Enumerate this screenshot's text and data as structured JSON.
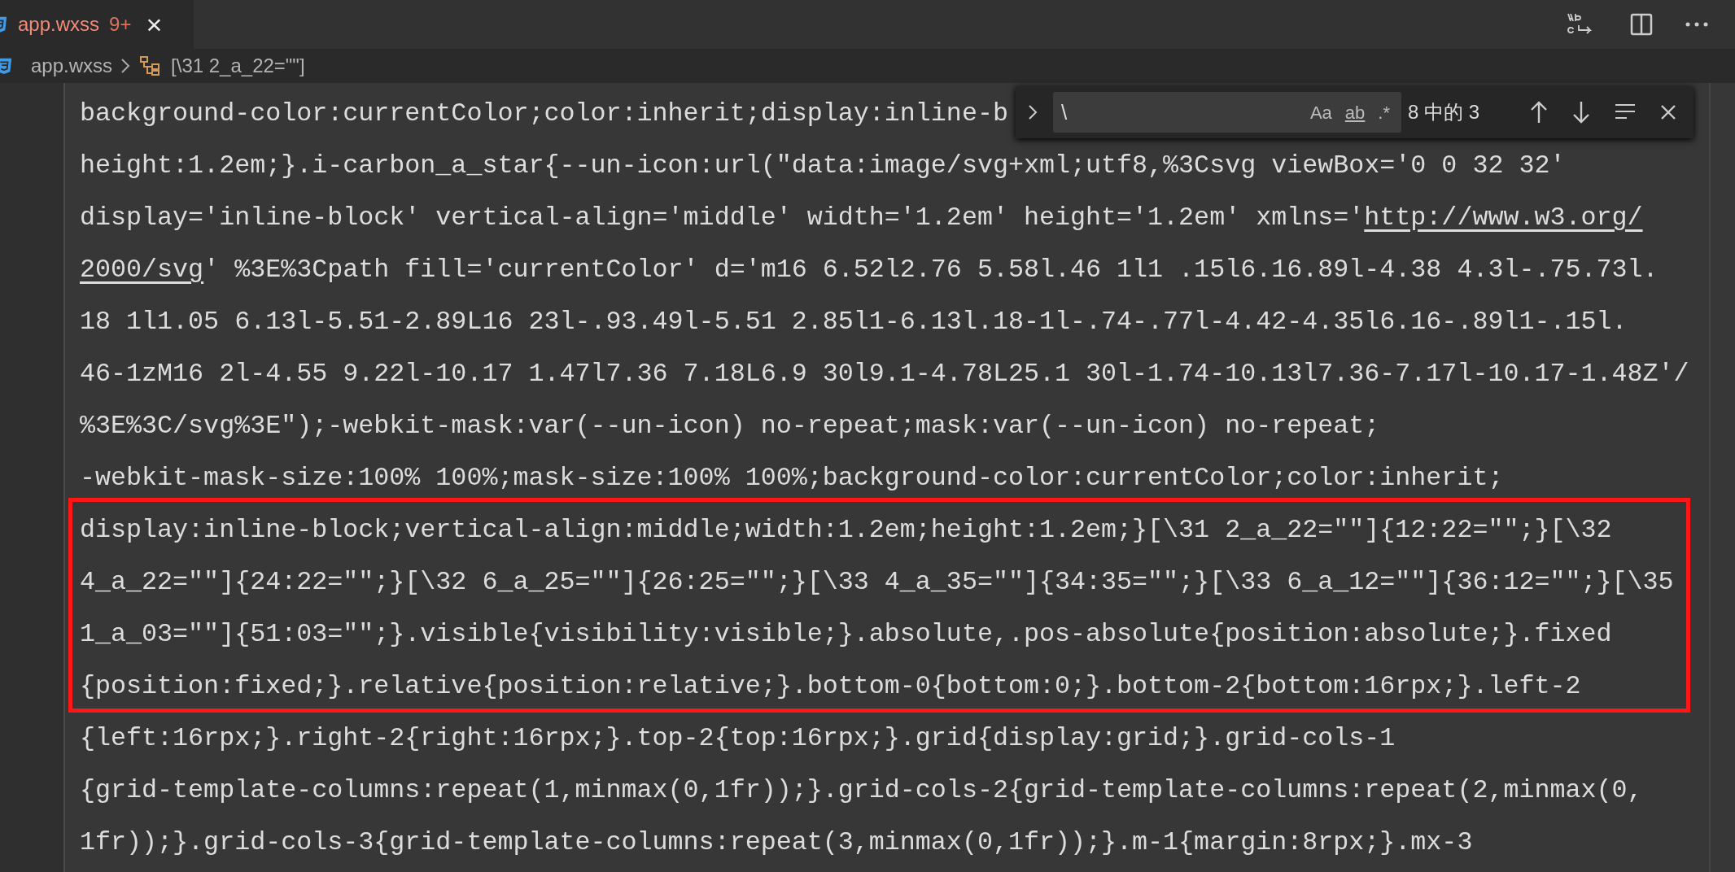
{
  "tab": {
    "label": "app.wxss",
    "badge": "9+",
    "close": "×",
    "selected": true
  },
  "breadcrumb": {
    "file": "app.wxss",
    "symbol": "[\\31 2_a_22=\"\"]"
  },
  "find": {
    "value": "\\",
    "toggles": [
      {
        "label": "Aa",
        "on": false
      },
      {
        "label": "ab",
        "on": false
      },
      {
        "label": ".*",
        "on": false
      }
    ],
    "count": "8 中的 3"
  },
  "lines": [
    {
      "parts": [
        {
          "kind": "code",
          "text": "background-color:currentColor;color:inherit;display:inline-b"
        }
      ]
    },
    {
      "parts": [
        {
          "kind": "code",
          "text": "height:1.2em;}.i-carbon_a_star{--un-icon:url(\"data:image/svg+xml;utf8,%3Csvg viewBox='0 0 32 32'"
        }
      ]
    },
    {
      "parts": [
        {
          "kind": "code",
          "text": "display='inline-block' vertical-align='middle' width='1.2em' height='1.2em' xmlns='"
        },
        {
          "kind": "link",
          "text": "http://www.w3.org/"
        }
      ]
    },
    {
      "parts": [
        {
          "kind": "link",
          "text": "2000/svg"
        },
        {
          "kind": "code",
          "text": "' %3E%3Cpath fill='currentColor' d='m16 6.52l2.76 5.58l.46 1l1 .15l6.16.89l-4.38 4.3l-.75.73l."
        }
      ]
    },
    {
      "parts": [
        {
          "kind": "code",
          "text": "18 1l1.05 6.13l-5.51-2.89L16 23l-.93.49l-5.51 2.85l1-6.13l.18-1l-.74-.77l-4.42-4.35l6.16-.89l1-.15l."
        }
      ]
    },
    {
      "parts": [
        {
          "kind": "code",
          "text": "46-1zM16 2l-4.55 9.22l-10.17 1.47l7.36 7.18L6.9 30l9.1-4.78L25.1 30l-1.74-10.13l7.36-7.17l-10.17-1.48Z'/"
        }
      ]
    },
    {
      "parts": [
        {
          "kind": "code",
          "text": "%3E%3C/svg%3E\");-webkit-mask:var(--un-icon) no-repeat;mask:var(--un-icon) no-repeat;"
        }
      ]
    },
    {
      "parts": [
        {
          "kind": "code",
          "text": "-webkit-mask-size:100% 100%;mask-size:100% 100%;background-color:currentColor;color:inherit;"
        }
      ]
    },
    {
      "parts": [
        {
          "kind": "code",
          "text": "display:inline-block;vertical-align:middle;width:1.2em;height:1.2em;}[\\31 2_a_22=\"\"]{12:22=\"\";}[\\32"
        }
      ]
    },
    {
      "parts": [
        {
          "kind": "code",
          "text": "4_a_22=\"\"]{24:22=\"\";}[\\32 6_a_25=\"\"]{26:25=\"\";}[\\33 4_a_35=\"\"]{34:35=\"\";}[\\33 6_a_12=\"\"]{36:12=\"\";}[\\35"
        }
      ]
    },
    {
      "parts": [
        {
          "kind": "code",
          "text": "1_a_03=\"\"]{51:03=\"\";}.visible{visibility:visible;}.absolute,.pos-absolute{position:absolute;}.fixed"
        }
      ]
    },
    {
      "parts": [
        {
          "kind": "code",
          "text": "{position:fixed;}.relative{position:relative;}.bottom-0{bottom:0;}.bottom-2{bottom:16rpx;}.left-2"
        }
      ]
    },
    {
      "parts": [
        {
          "kind": "code",
          "text": "{left:16rpx;}.right-2{right:16rpx;}.top-2{top:16rpx;}.grid{display:grid;}.grid-cols-1"
        }
      ]
    },
    {
      "parts": [
        {
          "kind": "code",
          "text": "{grid-template-columns:repeat(1,minmax(0,1fr));}.grid-cols-2{grid-template-columns:repeat(2,minmax(0,"
        }
      ]
    },
    {
      "parts": [
        {
          "kind": "code",
          "text": "1fr));}.grid-cols-3{grid-template-columns:repeat(3,minmax(0,1fr));}.m-1{margin:8rpx;}.mx-3"
        }
      ]
    }
  ]
}
